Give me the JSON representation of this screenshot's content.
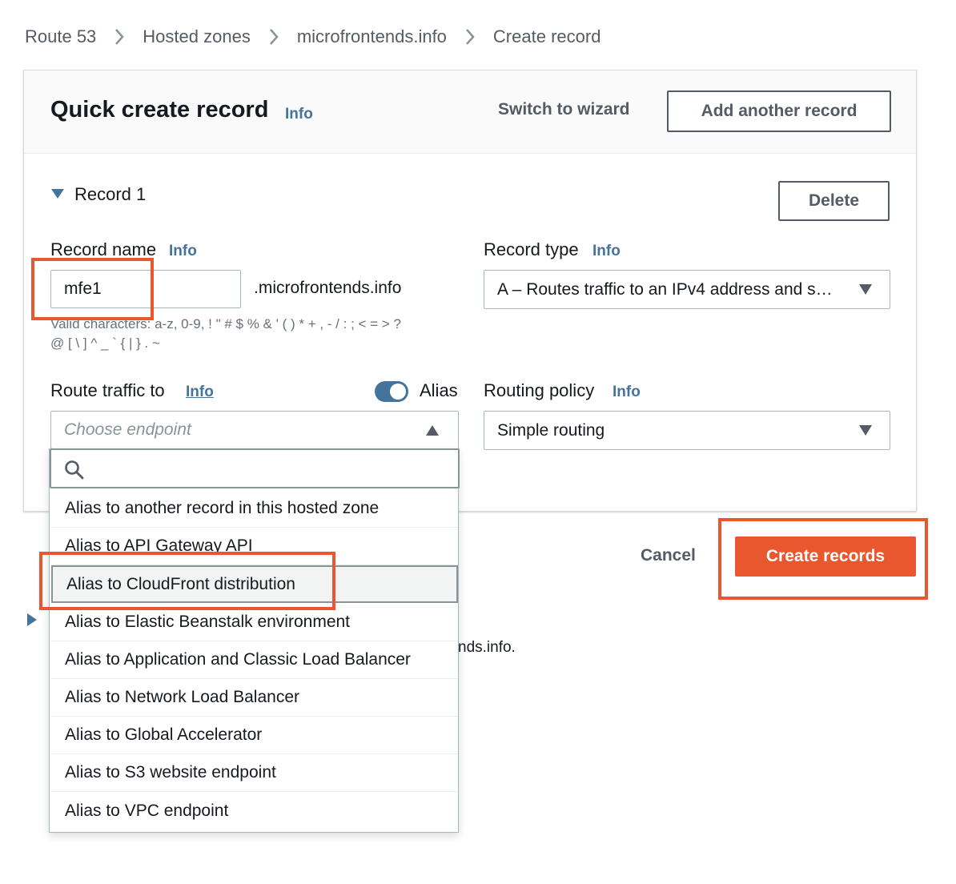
{
  "breadcrumb": {
    "items": [
      "Route 53",
      "Hosted zones",
      "microfrontends.info",
      "Create record"
    ]
  },
  "header": {
    "title": "Quick create record",
    "info": "Info",
    "switch_wizard": "Switch to wizard",
    "add_record": "Add another record"
  },
  "record": {
    "section_label": "Record 1",
    "delete": "Delete",
    "name_label": "Record name",
    "name_info": "Info",
    "name_value": "mfe1",
    "domain_suffix": ".microfrontends.info",
    "valid_chars_line1": "Valid characters: a-z, 0-9, ! \" # $ % & ' ( ) * + , - / : ; < = > ?",
    "valid_chars_line2": "@ [ \\ ] ^ _ ` { | } . ~",
    "type_label": "Record type",
    "type_info": "Info",
    "type_value": "A – Routes traffic to an IPv4 address and s…",
    "route_label": "Route traffic to",
    "route_info": "Info",
    "alias_label": "Alias",
    "alias_enabled": true,
    "endpoint_placeholder": "Choose endpoint",
    "policy_label": "Routing policy",
    "policy_info": "Info",
    "policy_value": "Simple routing"
  },
  "dropdown": {
    "search_placeholder": "",
    "options": [
      "Alias to another record in this hosted zone",
      "Alias to API Gateway API",
      "Alias to CloudFront distribution",
      "Alias to Elastic Beanstalk environment",
      "Alias to Application and Classic Load Balancer",
      "Alias to Network Load Balancer",
      "Alias to Global Accelerator",
      "Alias to S3 website endpoint",
      "Alias to VPC endpoint"
    ],
    "highlighted_index": 2
  },
  "footer": {
    "cancel": "Cancel",
    "create": "Create records",
    "partial_text": "nds.info."
  },
  "colors": {
    "primary": "#e8572e",
    "link": "#44749b",
    "callout": "#e8572e"
  }
}
